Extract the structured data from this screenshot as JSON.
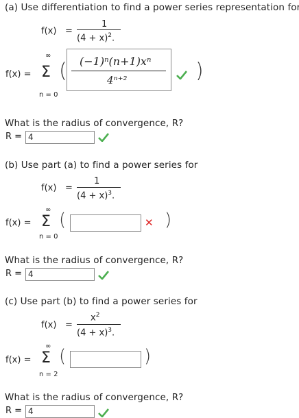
{
  "part_a": {
    "prompt": "(a) Use differentiation to find a power series representation for",
    "f_label": "f(x)",
    "equals": "=",
    "numerator": "1",
    "denominator_base": "(4 + x)",
    "denominator_exp": "2",
    "period": ".",
    "series_label": "f(x)",
    "sum_upper": "∞",
    "sum_lower": "n = 0",
    "answer_numerator": "(−1)ⁿ(n+1)xⁿ",
    "answer_denominator": "4ⁿ⁺²",
    "answer_status": "correct",
    "radius_question": "What is the radius of convergence, R?",
    "radius_label": "R =",
    "radius_value": "4",
    "radius_status": "correct"
  },
  "part_b": {
    "prompt": "(b) Use part (a) to find a power series for",
    "f_label": "f(x)",
    "equals": "=",
    "numerator": "1",
    "denominator_base": "(4 + x)",
    "denominator_exp": "3",
    "period": ".",
    "series_label": "f(x)",
    "sum_upper": "∞",
    "sum_lower": "n = 0",
    "answer_value": "",
    "answer_status": "incorrect",
    "radius_question": "What is the radius of convergence, R?",
    "radius_label": "R =",
    "radius_value": "4",
    "radius_status": "correct"
  },
  "part_c": {
    "prompt": "(c) Use part (b) to find a power series for",
    "f_label": "f(x)",
    "equals": "=",
    "numerator_base": "x",
    "numerator_exp": "2",
    "denominator_base": "(4 + x)",
    "denominator_exp": "3",
    "period": ".",
    "series_label": "f(x)",
    "sum_upper": "∞",
    "sum_lower": "n = 2",
    "answer_value": "",
    "radius_question": "What is the radius of convergence, R?",
    "radius_label": "R =",
    "radius_value": "4",
    "radius_status": "correct"
  },
  "colors": {
    "correct": "#4caf50",
    "incorrect": "#d9302b",
    "border": "#888888"
  }
}
